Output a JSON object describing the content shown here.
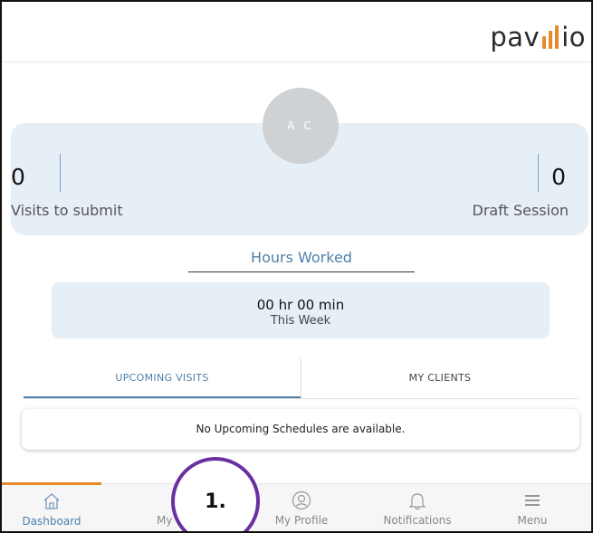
{
  "header": {
    "logo_text_1": "pav",
    "logo_text_2": "io"
  },
  "profile": {
    "initials": "A C"
  },
  "stats": {
    "left": {
      "value": "0",
      "label": "Visits to submit"
    },
    "right": {
      "value": "0",
      "label": "Draft Session"
    }
  },
  "hours": {
    "title": "Hours Worked",
    "value": "00 hr 00 min",
    "period": "This Week"
  },
  "tabs": [
    {
      "label": "UPCOMING VISITS",
      "active": true
    },
    {
      "label": "MY CLIENTS",
      "active": false
    }
  ],
  "empty_message": "No Upcoming Schedules are available.",
  "bottom_nav": [
    {
      "label": "Dashboard",
      "icon": "home-icon",
      "active": true
    },
    {
      "label": "My",
      "icon": "visits-icon",
      "active": false
    },
    {
      "label": "My Profile",
      "icon": "profile-icon",
      "active": false
    },
    {
      "label": "Notifications",
      "icon": "bell-icon",
      "active": false
    },
    {
      "label": "Menu",
      "icon": "hamburger-icon",
      "active": false
    }
  ],
  "callout": {
    "label": "1."
  },
  "colors": {
    "accent": "#4f80a9",
    "brand_orange": "#e8892a",
    "callout_purple": "#6b2fa1",
    "card_bg": "#e6eef6"
  }
}
